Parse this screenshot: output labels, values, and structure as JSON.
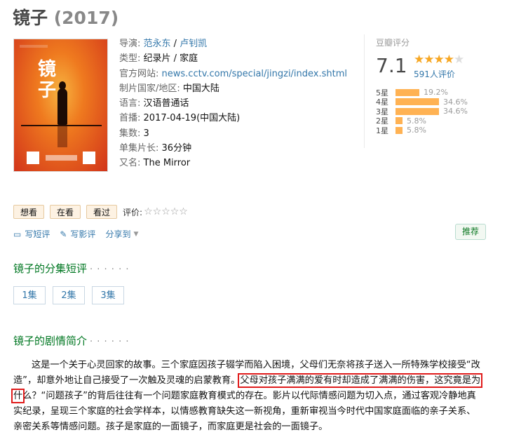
{
  "movie": {
    "title": "镜子",
    "year": "(2017)"
  },
  "info": {
    "director_label": "导演:",
    "directors": [
      "范永东",
      "卢钊凯"
    ],
    "director_sep": " / ",
    "genre_label": "类型:",
    "genre": "纪录片 / 家庭",
    "site_label": "官方网站:",
    "site": "news.cctv.com/special/jingzi/index.shtml",
    "country_label": "制片国家/地区:",
    "country": "中国大陆",
    "language_label": "语言:",
    "language": "汉语普通话",
    "premiere_label": "首播:",
    "premiere": "2017-04-19(中国大陆)",
    "episodes_label": "集数:",
    "episodes": "3",
    "runtime_label": "单集片长:",
    "runtime": "36分钟",
    "aka_label": "又名:",
    "aka": "The Mirror"
  },
  "poster": {
    "title_text": "镜子"
  },
  "rating": {
    "label": "豆瓣评分",
    "score": "7.1",
    "stars": 3.5,
    "votes": "591人评价",
    "distribution": [
      {
        "label": "5星",
        "percent": "19.2%",
        "value": 19.2
      },
      {
        "label": "4星",
        "percent": "34.6%",
        "value": 34.6
      },
      {
        "label": "3星",
        "percent": "34.6%",
        "value": 34.6
      },
      {
        "label": "2星",
        "percent": "5.8%",
        "value": 5.8
      },
      {
        "label": "1星",
        "percent": "5.8%",
        "value": 5.8
      }
    ],
    "star_color": "#f6a723",
    "bar_color": "#ffb253"
  },
  "actions": {
    "want": "想看",
    "watching": "在看",
    "watched": "看过",
    "rate_label": "评价:",
    "rate_stars": "☆☆☆☆☆"
  },
  "writes": {
    "short_review": "写短评",
    "review": "写影评",
    "share": "分享到",
    "short_review_icon": "comment-icon",
    "review_icon": "pencil-icon"
  },
  "recommend": "推荐",
  "episodes_section": {
    "title": "镜子的分集短评",
    "dots": "· · · · · ·",
    "items": [
      "1集",
      "2集",
      "3集"
    ]
  },
  "summary_section": {
    "title": "镜子的剧情简介",
    "dots": "· · · · · ·",
    "text_before": "这是一个关于心灵回家的故事。三个家庭因孩子辍学而陷入困境，父母们无奈将孩子送入一所特殊学校接受“改造”，却意外地让自己接受了一次触及灵魂的启蒙教育。",
    "text_highlight": "父母对孩子满满的爱有时却造成了满满的伤害，这究竟是为什",
    "text_after": "么？“问题孩子”的背后往往有一个问题家庭教育模式的存在。影片以代际情感问题为切入点，通过客观冷静地真实纪录，呈现三个家庭的社会学样本，以情感教育缺失这一新视角，重新审视当今时代中国家庭面临的亲子关系、亲密关系等情感问题。孩子是家庭的一面镜子，而家庭更是社会的一面镜子。",
    "highlight_color": "#e01b1b"
  },
  "colors": {
    "link": "#3377aa",
    "section_green": "#007722"
  }
}
